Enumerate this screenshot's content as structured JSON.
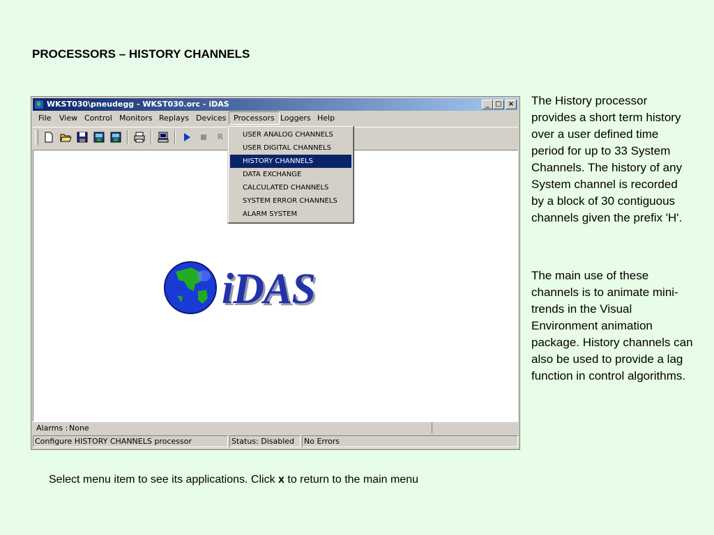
{
  "slide": {
    "title": "PROCESSORS – HISTORY CHANNELS",
    "description_1": "The History processor provides a short term history over a user defined time period for up to 33 System Channels. The history of any System channel is recorded by a block of 30 contiguous channels given the prefix 'H'.",
    "description_2": "The main use of these channels is to animate mini-trends in the Visual Environment animation package. History channels can also be used to provide a lag function in control algorithms.",
    "footer_before": "Select menu item to see its applications. Click ",
    "footer_key": "x",
    "footer_after": " to return to the main menu"
  },
  "window": {
    "title": "WKST030\\pneudegg - WKST030.orc - iDAS",
    "buttons": {
      "minimize": "_",
      "maximize": "□",
      "close": "×"
    }
  },
  "menu": {
    "items": [
      "File",
      "View",
      "Control",
      "Monitors",
      "Replays",
      "Devices",
      "Processors",
      "Loggers",
      "Help"
    ],
    "open_menu": "Processors"
  },
  "dropdown": {
    "items": [
      "USER ANALOG CHANNELS",
      "USER DIGITAL CHANNELS",
      "HISTORY CHANNELS",
      "DATA EXCHANGE",
      "CALCULATED CHANNELS",
      "SYSTEM ERROR CHANNELS",
      "ALARM SYSTEM"
    ],
    "highlighted": "HISTORY CHANNELS"
  },
  "toolbar": {
    "icons": [
      "new-file-icon",
      "open-folder-icon",
      "save-icon",
      "save-as-icon-1",
      "save-as-icon-2",
      "print-icon",
      "monitor-icon",
      "play-icon",
      "stop-icon",
      "record-icon"
    ],
    "record_label": "R"
  },
  "logo": {
    "text": "iDAS",
    "colors": {
      "globe_ocean": "#1a3ad6",
      "globe_land": "#22aa22",
      "text": "#2233aa"
    }
  },
  "alarms": {
    "label": "Alarms :",
    "value": "None"
  },
  "status": {
    "message": "Configure HISTORY CHANNELS processor",
    "state": "Status: Disabled",
    "errors": "No Errors"
  },
  "colors": {
    "background": "#e8fde8",
    "titlebar": "#0a246a",
    "highlight": "#0a246a",
    "chrome": "#d4d0c8"
  }
}
